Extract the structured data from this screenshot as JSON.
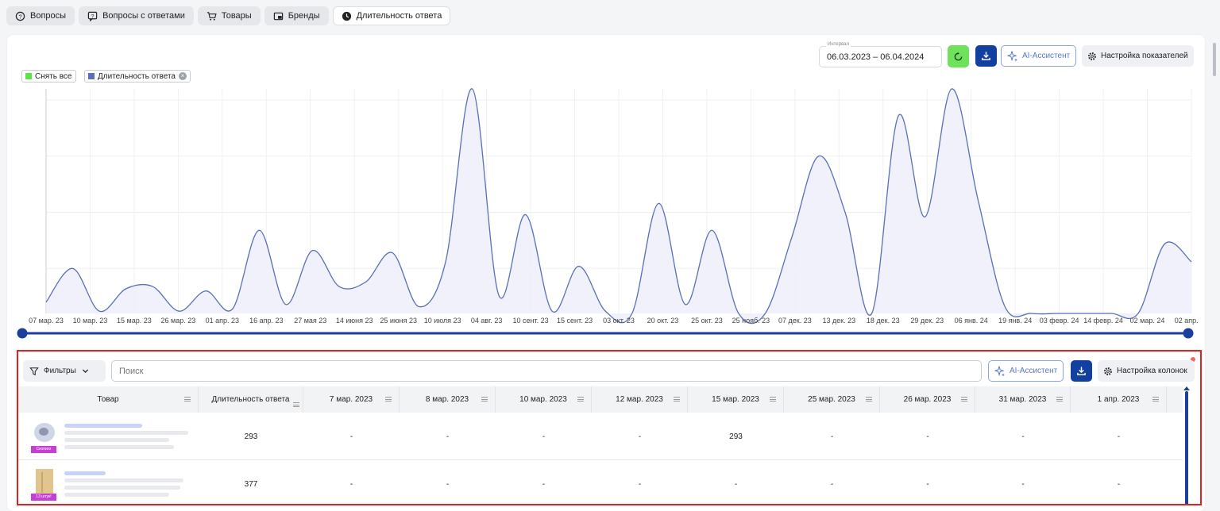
{
  "tabs": [
    {
      "label": "Вопросы",
      "icon": "question-circle-icon"
    },
    {
      "label": "Вопросы с ответами",
      "icon": "question-chat-icon"
    },
    {
      "label": "Товары",
      "icon": "cart-icon"
    },
    {
      "label": "Бренды",
      "icon": "brand-card-icon"
    },
    {
      "label": "Длительность ответа",
      "icon": "clock-icon",
      "active": true
    }
  ],
  "header": {
    "interval_label": "Интервал",
    "interval_value": "06.03.2023 – 06.04.2024",
    "ai_label": "AI-Ассистент",
    "settings_label": "Настройка показателей"
  },
  "legend": {
    "deselect_all": "Снять все",
    "series_label": "Длительность ответа",
    "deselect_color": "#5ee24a",
    "series_color": "#5a6fb8"
  },
  "chart_data": {
    "type": "area",
    "x": [
      "07 мар. 23",
      "10 мар. 23",
      "15 мар. 23",
      "26 мар. 23",
      "01 апр. 23",
      "16 апр. 23",
      "27 мая 23",
      "14 июня 23",
      "25 июня 23",
      "10 июля 23",
      "04 авг. 23",
      "10 сент. 23",
      "15 сент. 23",
      "03 окт. 23",
      "20 окт. 23",
      "25 окт. 23",
      "25 нояб. 23",
      "07 дек. 23",
      "13 дек. 23",
      "18 дек. 23",
      "29 дек. 23",
      "06 янв. 24",
      "19 янв. 24",
      "03 февр. 24",
      "14 февр. 24",
      "02 мар. 24",
      "02 апр. 24"
    ],
    "series": [
      {
        "values": [
          5,
          20,
          1,
          11,
          12,
          1,
          10,
          2,
          37,
          4,
          28,
          12,
          14,
          27,
          3,
          23,
          100,
          8,
          44,
          1,
          21,
          1,
          0,
          49,
          4,
          37,
          0,
          0,
          34,
          70,
          45,
          0,
          88,
          43,
          100,
          50,
          3,
          0,
          0,
          0,
          0,
          0,
          31,
          23
        ]
      }
    ],
    "ylim": [
      0,
      100
    ],
    "grid": true,
    "color": "#5a6fb8",
    "fill": "#eef0fb"
  },
  "table": {
    "filters_label": "Фильтры",
    "search_placeholder": "Поиск",
    "ai_label": "AI-Ассистент",
    "settings_label": "Настройка колонок",
    "columns": [
      "Товар",
      "Длительность ответа",
      "7 мар. 2023",
      "8 мар. 2023",
      "10 мар. 2023",
      "12 мар. 2023",
      "15 мар. 2023",
      "25 мар. 2023",
      "26 мар. 2023",
      "31 мар. 2023",
      "1 апр. 2023"
    ],
    "rows": [
      {
        "thumb_label": "Скопиго",
        "duration": "293",
        "cells": [
          "-",
          "-",
          "-",
          "-",
          "293",
          "-",
          "-",
          "-",
          "-"
        ]
      },
      {
        "thumb_label": "13 штук!",
        "duration": "377",
        "cells": [
          "-",
          "-",
          "-",
          "-",
          "-",
          "-",
          "-",
          "-",
          "-"
        ]
      }
    ]
  }
}
